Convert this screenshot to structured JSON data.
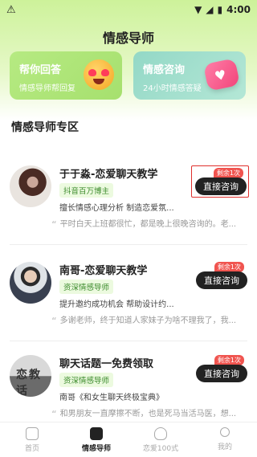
{
  "statusbar": {
    "time": "4:00"
  },
  "header": {
    "title": "情感导师"
  },
  "cards": [
    {
      "title": "帮你回答",
      "subtitle": "情感导师帮回复"
    },
    {
      "title": "情感咨询",
      "subtitle": "24小时情感答疑"
    }
  ],
  "section_title": "情感导师专区",
  "mentors": [
    {
      "name": "于于淼-恋爱聊天教学",
      "badge": "抖音百万博主",
      "desc": "擅长情感心理分析  制造恋爱氛...",
      "quote": "平时白天上班都很忙，都是晚上很晚咨询的。老...",
      "remain": "剩余1次",
      "button": "直接咨询"
    },
    {
      "name": "南哥-恋爱聊天教学",
      "badge": "资深情感导师",
      "desc": "提升邀约成功机会  帮助设计约...",
      "quote": "多谢老师，终于知道人家妹子为啥不理我了，我...",
      "remain": "剩余1次",
      "button": "直接咨询"
    },
    {
      "name": "聊天话题一免费领取",
      "badge": "资深情感导师",
      "desc": "南哥《和女生聊天终极宝典》",
      "quote": "和男朋友一直摩擦不断，也是死马当活马医，想...",
      "remain": "剩余1次",
      "button": "直接咨询",
      "avatar_text": "恋教话"
    }
  ],
  "tabs": [
    {
      "label": "首页",
      "icon": "home-icon",
      "active": false
    },
    {
      "label": "情感导师",
      "icon": "heart-chat-icon",
      "active": true
    },
    {
      "label": "恋爱100式",
      "icon": "heart-icon",
      "active": false
    },
    {
      "label": "我的",
      "icon": "person-icon",
      "active": false
    }
  ]
}
